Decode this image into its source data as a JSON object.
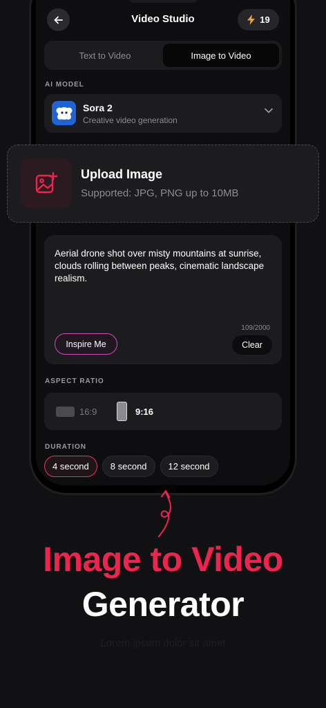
{
  "header": {
    "title": "Video Studio",
    "credits": "19",
    "back_icon": "arrow-left-icon",
    "credits_icon": "lightning-icon"
  },
  "tabs": [
    {
      "label": "Text to Video",
      "active": false
    },
    {
      "label": "Image to Video",
      "active": true
    }
  ],
  "model": {
    "section_label": "AI MODEL",
    "name": "Sora 2",
    "description": "Creative video generation"
  },
  "upload": {
    "title": "Upload Image",
    "subtitle": "Supported: JPG, PNG up to 10MB"
  },
  "prompt": {
    "text": "Aerial drone shot over misty mountains at sunrise, clouds rolling between peaks, cinematic landscape realism.",
    "counter": "109/2000",
    "inspire_label": "Inspire Me",
    "clear_label": "Clear"
  },
  "aspect_ratio": {
    "section_label": "ASPECT RATIO",
    "options": [
      "16:9",
      "9:16"
    ],
    "selected": "9:16"
  },
  "duration": {
    "section_label": "DURATION",
    "options": [
      "4 second",
      "8 second",
      "12 second"
    ],
    "selected": "4 second"
  },
  "promo": {
    "headline_line1": "Image to Video",
    "headline_line2": "Generator",
    "tagline": "Lorem ipsum dolor sit amet"
  },
  "colors": {
    "accent": "#f0234f",
    "background": "#111113",
    "card": "#1c1c1f",
    "inspire_border": "#d24bb7"
  }
}
